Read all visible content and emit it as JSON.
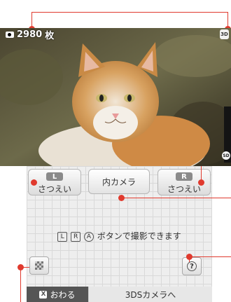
{
  "top_screen": {
    "shot_count": "2980",
    "shot_unit": "枚",
    "badge_3d": "3D",
    "sd_badge": "SD"
  },
  "bottom_screen": {
    "l_button": {
      "key": "L",
      "label": "さつえい"
    },
    "inner_camera_label": "内カメラ",
    "r_button": {
      "key": "R",
      "label": "さつえい"
    },
    "hint": {
      "keys": [
        "L",
        "R",
        "A"
      ],
      "text": "ボタンで撮影できます"
    },
    "help_glyph": "?",
    "end_button": {
      "key": "X",
      "label": "おわる"
    },
    "to_3ds_camera": "3DSカメラへ"
  },
  "colors": {
    "callout": "#e03a2e",
    "end_bar": "#555555"
  }
}
